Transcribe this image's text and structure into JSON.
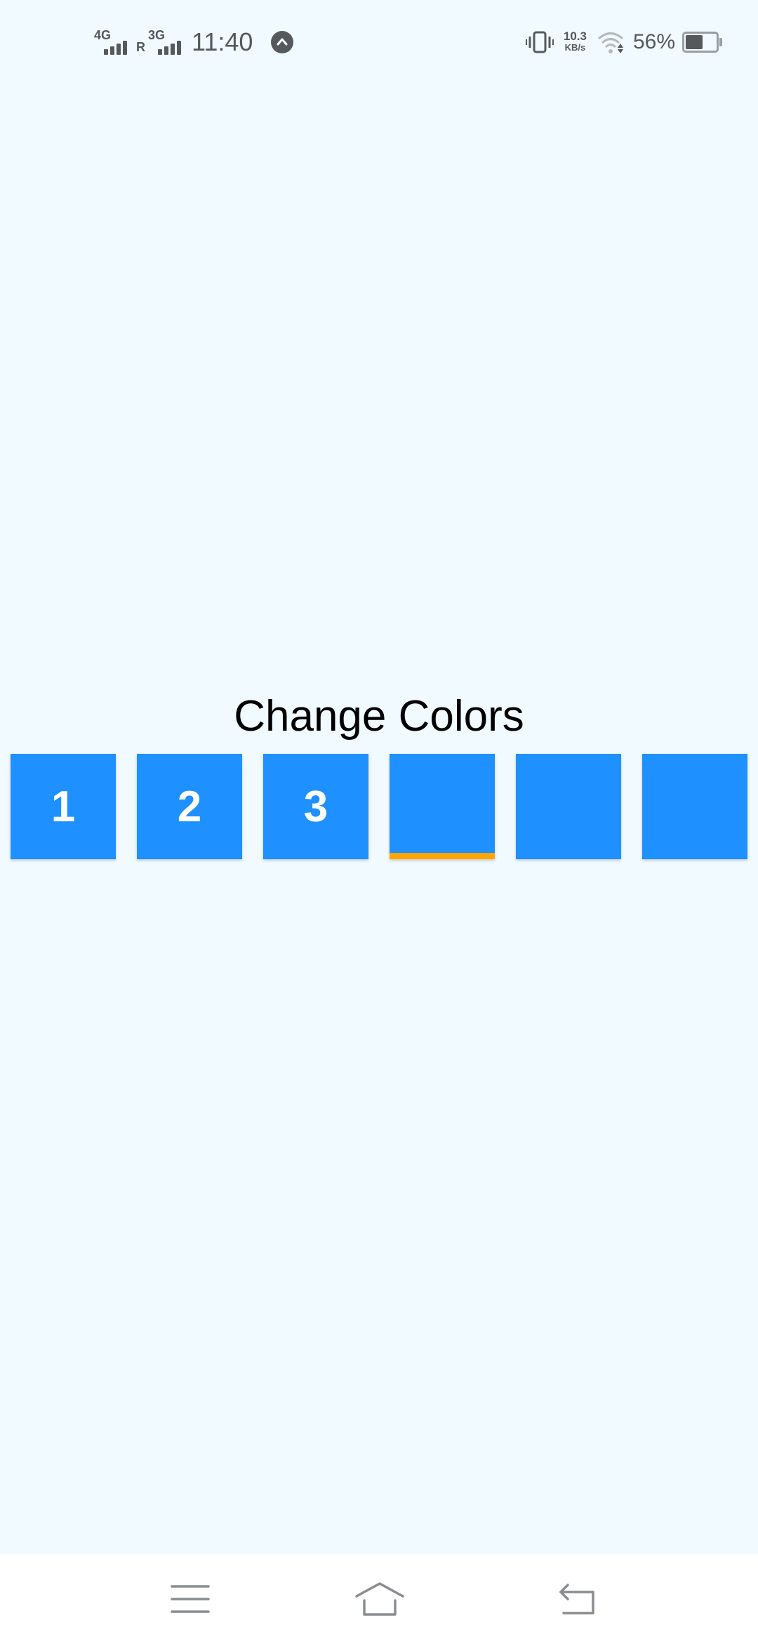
{
  "status_bar": {
    "network1": "4G",
    "roaming": "R",
    "network2": "3G",
    "time": "11:40",
    "speed_value": "10.3",
    "speed_unit": "KB/s",
    "battery_percent": "56%",
    "battery_level": 0.56
  },
  "main": {
    "title": "Change Colors",
    "tiles": [
      {
        "label": "1",
        "selected": false
      },
      {
        "label": "2",
        "selected": false
      },
      {
        "label": "3",
        "selected": false
      },
      {
        "label": "",
        "selected": true
      },
      {
        "label": "",
        "selected": false
      },
      {
        "label": "",
        "selected": false
      }
    ],
    "tile_color": "#1E90FF",
    "selected_indicator_color": "#FFA500"
  },
  "nav_bar": {
    "icons": [
      "menu-icon",
      "home-icon",
      "back-icon"
    ]
  },
  "colors": {
    "background": "#F1FAFF",
    "status_text": "#55595C"
  }
}
